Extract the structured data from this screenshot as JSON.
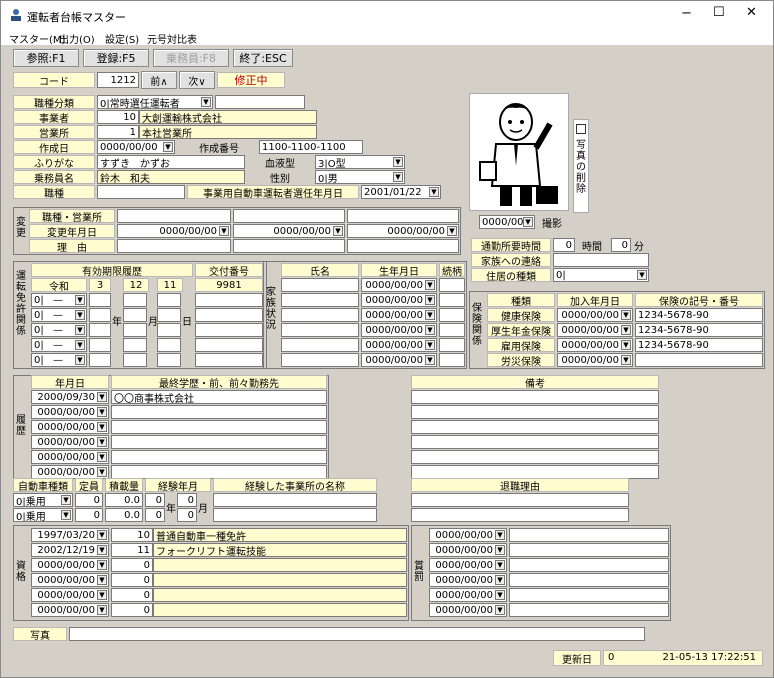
{
  "window": {
    "title": "運転者台帳マスター",
    "minimize": "−",
    "maximize": "☐",
    "close": "✕"
  },
  "menu": [
    "マスター(M)",
    "出力(O)",
    "設定(S)",
    "元号対比表"
  ],
  "toolbar": {
    "ref": "参照:F1",
    "reg": "登録:F5",
    "crew": "乗務員:F8",
    "exit": "終了:ESC"
  },
  "nav": {
    "code_label": "コード",
    "code": "1212",
    "prev": "前∧",
    "next": "次∨",
    "status": "修正中"
  },
  "basic": {
    "shokushu_bunrui_label": "職種分類",
    "shokushu_bunrui": "0|常時選任運転者",
    "shokushu_bunrui_extra": "",
    "jigyosha_label": "事業者",
    "jigyosha_no": "10",
    "jigyosha_name": "大創運輸株式会社",
    "eigyosho_label": "営業所",
    "eigyosho_no": "1",
    "eigyosho_name": "本社営業所",
    "sakuseibi_label": "作成日",
    "sakuseibi": "0000/00/00",
    "sakusei_no_label": "作成番号",
    "sakusei_no": "1100-1100-1100",
    "furigana_label": "ふりがな",
    "furigana": "すずき　かずお",
    "blood_label": "血液型",
    "blood": "3|O型",
    "name_label": "乗務員名",
    "name": "鈴木　和夫",
    "sex_label": "性別",
    "sex": "0|男",
    "shokushu_label": "職種",
    "shokushu": "",
    "senin_label": "事業用自動車運転者選任年月日",
    "senin": "2001/01/22"
  },
  "photo": {
    "date": "0000/00/00",
    "shoot": "撮影",
    "delete_label": "写真の削除"
  },
  "henko": {
    "side": "変更",
    "r1": "職種・営業所",
    "r2": "変更年月日",
    "r3": "理　由",
    "date1": "0000/00/00",
    "date2": "0000/00/00",
    "date3": "0000/00/00"
  },
  "commute": {
    "label": "通勤所要時間",
    "hours": "0",
    "hours_unit": "時間",
    "minutes": "0",
    "minutes_unit": "分",
    "family_label": "家族への連絡",
    "family": "",
    "housing_label": "住居の種類",
    "housing": "0|"
  },
  "license": {
    "side": "運転免許関係",
    "header": "有効期限履歴",
    "koufu_header": "交付番号",
    "era": "令和",
    "y": "3",
    "m": "12",
    "d": "11",
    "koufu": "9981",
    "era_rows": [
      "0|",
      "0|",
      "0|",
      "0|",
      "0|"
    ],
    "dash": "—",
    "nen": "年",
    "tsuki": "月",
    "hi": "日"
  },
  "family": {
    "side": "家族状況",
    "name_h": "氏名",
    "birth_h": "生年月日",
    "rel_h": "続柄",
    "dates": [
      "0000/00/00",
      "0000/00/00",
      "0000/00/00",
      "0000/00/00",
      "0000/00/00",
      "0000/00/00"
    ]
  },
  "insurance": {
    "side": "保険関係",
    "type_h": "種類",
    "join_h": "加入年月日",
    "no_h": "保険の記号・番号",
    "rows": [
      {
        "type": "健康保険",
        "date": "0000/00/00",
        "no": "1234-5678-90"
      },
      {
        "type": "厚生年金保険",
        "date": "0000/00/00",
        "no": "1234-5678-90"
      },
      {
        "type": "雇用保険",
        "date": "0000/00/00",
        "no": "1234-5678-90"
      },
      {
        "type": "労災保険",
        "date": "0000/00/00",
        "no": ""
      }
    ]
  },
  "history": {
    "side": "履歴",
    "date_h": "年月日",
    "text_h": "最終学歴・前、前々勤務先",
    "bikou_h": "備考",
    "rows": [
      {
        "date": "2000/09/30",
        "text": "〇〇商事株式会社"
      },
      {
        "date": "0000/00/00",
        "text": ""
      },
      {
        "date": "0000/00/00",
        "text": ""
      },
      {
        "date": "0000/00/00",
        "text": ""
      },
      {
        "date": "0000/00/00",
        "text": ""
      },
      {
        "date": "0000/00/00",
        "text": ""
      }
    ]
  },
  "vehicle": {
    "type_h": "自動車種類",
    "cap_h": "定員",
    "load_h": "積載量",
    "exp_h": "経験年月",
    "office_h": "経験した事業所の名称",
    "retire_h": "退職理由",
    "rows": [
      {
        "type": "0|乗用",
        "cap": "0",
        "load": "0.0",
        "y": "0",
        "m": "0"
      },
      {
        "type": "0|乗用",
        "cap": "0",
        "load": "0.0",
        "y": "0",
        "m": "0"
      }
    ],
    "nen": "年",
    "tsuki": "月"
  },
  "qual": {
    "side": "資格",
    "rows": [
      {
        "date": "1997/03/20",
        "no": "10",
        "name": "普通自動車一種免許"
      },
      {
        "date": "2002/12/19",
        "no": "11",
        "name": "フォークリフト運転技能"
      },
      {
        "date": "0000/00/00",
        "no": "0",
        "name": ""
      },
      {
        "date": "0000/00/00",
        "no": "0",
        "name": ""
      },
      {
        "date": "0000/00/00",
        "no": "0",
        "name": ""
      },
      {
        "date": "0000/00/00",
        "no": "0",
        "name": ""
      }
    ]
  },
  "shobatsu": {
    "side": "賞罰",
    "dates": [
      "0000/00/00",
      "0000/00/00",
      "0000/00/00",
      "0000/00/00",
      "0000/00/00",
      "0000/00/00"
    ]
  },
  "photo_path": {
    "label": "写真",
    "value": ""
  },
  "footer": {
    "updated_label": "更新日",
    "updated_no": "0",
    "updated_at": "21-05-13 17:22:51"
  }
}
